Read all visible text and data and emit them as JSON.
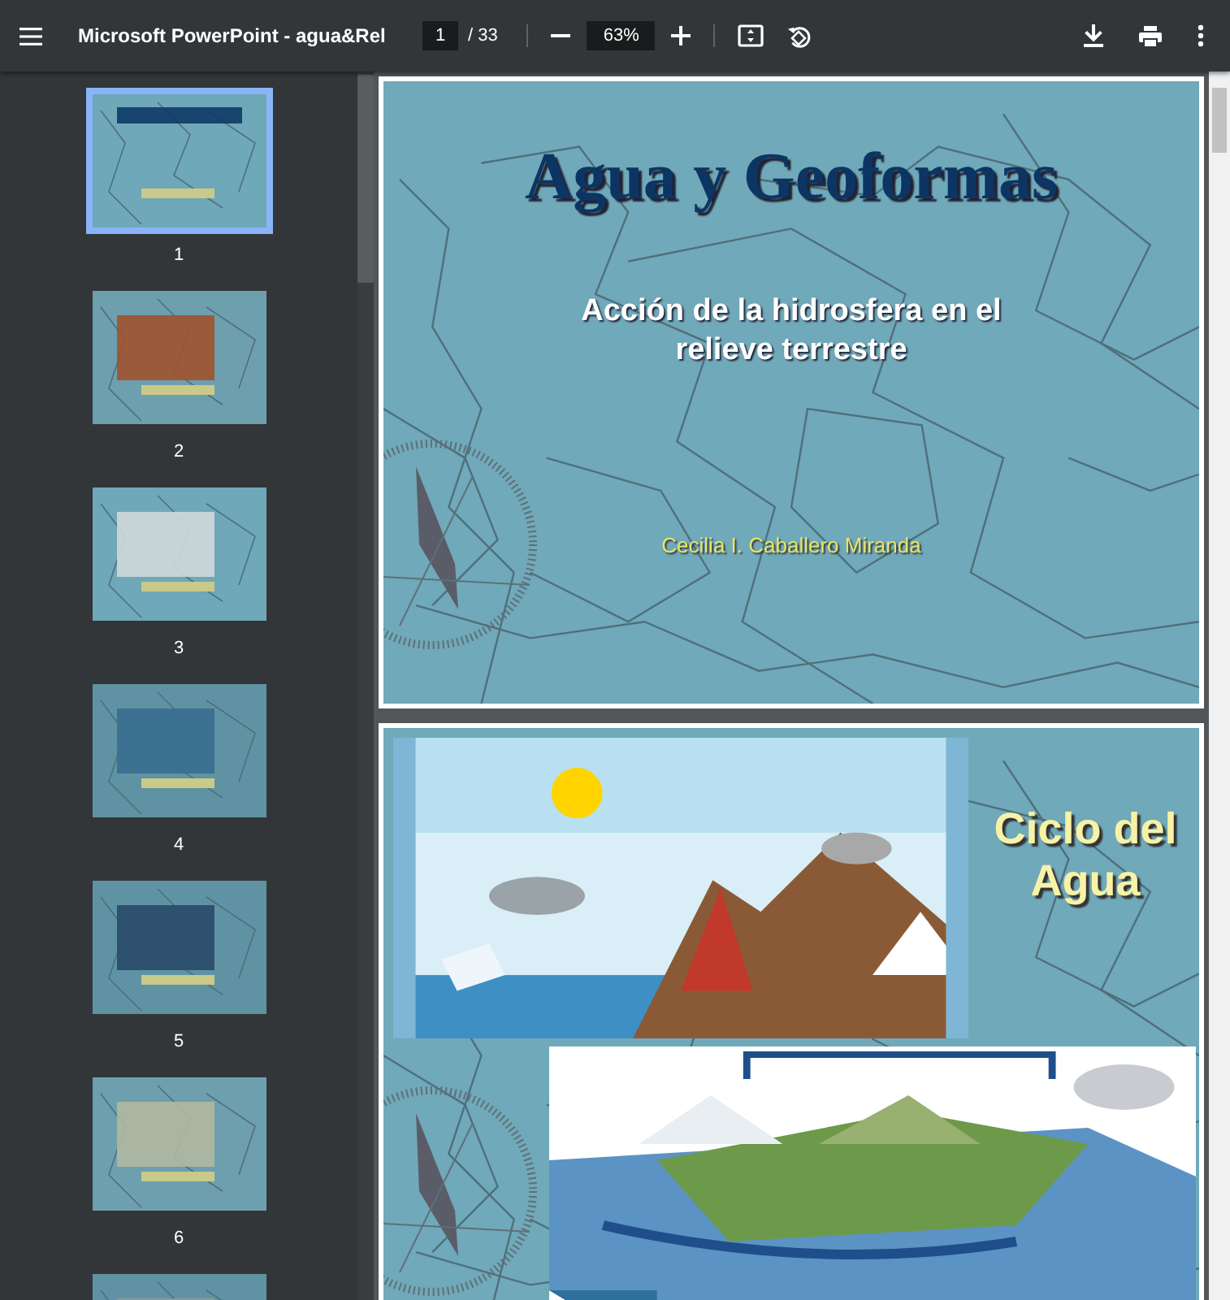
{
  "toolbar": {
    "title": "Microsoft PowerPoint - agua&Rel",
    "page_input": "1",
    "page_total": "/ 33",
    "zoom": "63%"
  },
  "thumbnails": [
    {
      "label": "1",
      "selected": true
    },
    {
      "label": "2",
      "selected": false
    },
    {
      "label": "3",
      "selected": false
    },
    {
      "label": "4",
      "selected": false
    },
    {
      "label": "5",
      "selected": false
    },
    {
      "label": "6",
      "selected": false
    },
    {
      "selected": false
    }
  ],
  "pages": [
    {
      "kind": "title",
      "title": "Agua y Geoformas",
      "subtitle": "Acción de la hidrosfera en el relieve terrestre",
      "author": "Cecilia I. Caballero Miranda"
    },
    {
      "kind": "figure",
      "heading": "Ciclo del Agua"
    }
  ]
}
